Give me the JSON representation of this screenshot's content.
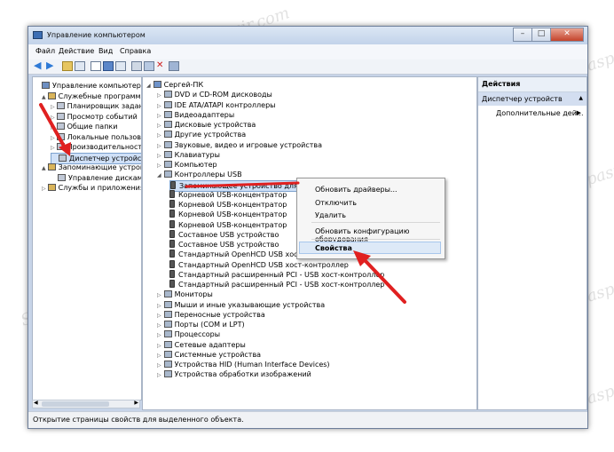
{
  "window": {
    "title": "Управление компьютером",
    "controls": [
      "–",
      "□",
      "✕"
    ]
  },
  "menu": [
    "Файл",
    "Действие",
    "Вид",
    "Справка"
  ],
  "left_tree": [
    {
      "label": "Управление компьютером (л",
      "indent": 0,
      "expander": ""
    },
    {
      "label": "Служебные программы",
      "indent": 1,
      "expander": "▲"
    },
    {
      "label": "Планировщик заданий",
      "indent": 2,
      "expander": "▷"
    },
    {
      "label": "Просмотр событий",
      "indent": 2,
      "expander": "▷"
    },
    {
      "label": "Общие папки",
      "indent": 2,
      "expander": "▷"
    },
    {
      "label": "Локальные пользовате",
      "indent": 2,
      "expander": "▷"
    },
    {
      "label": "Производительность",
      "indent": 2,
      "expander": "▷"
    },
    {
      "label": "Диспетчер устройств",
      "indent": 2,
      "expander": ""
    },
    {
      "label": "Запоминающие устройст",
      "indent": 1,
      "expander": "▲"
    },
    {
      "label": "Управление дисками",
      "indent": 2,
      "expander": ""
    },
    {
      "label": "Службы и приложения",
      "indent": 1,
      "expander": "▷"
    }
  ],
  "device_tree": [
    {
      "label": "Сергей-ПК",
      "indent": 0,
      "expander": "◢"
    },
    {
      "label": "DVD и CD-ROM дисководы",
      "indent": 1,
      "expander": "▷"
    },
    {
      "label": "IDE ATA/ATAPI контроллеры",
      "indent": 1,
      "expander": "▷"
    },
    {
      "label": "Видеоадаптеры",
      "indent": 1,
      "expander": "▷"
    },
    {
      "label": "Дисковые устройства",
      "indent": 1,
      "expander": "▷"
    },
    {
      "label": "Другие устройства",
      "indent": 1,
      "expander": "▷"
    },
    {
      "label": "Звуковые, видео и игровые устройства",
      "indent": 1,
      "expander": "▷"
    },
    {
      "label": "Клавиатуры",
      "indent": 1,
      "expander": "▷"
    },
    {
      "label": "Компьютер",
      "indent": 1,
      "expander": "▷"
    },
    {
      "label": "Контроллеры USB",
      "indent": 1,
      "expander": "◢"
    },
    {
      "label": "Запоминающее устройство для USB",
      "indent": 2,
      "expander": ""
    },
    {
      "label": "Корневой USB-концентратор",
      "indent": 2,
      "expander": ""
    },
    {
      "label": "Корневой USB-концентратор",
      "indent": 2,
      "expander": ""
    },
    {
      "label": "Корневой USB-концентратор",
      "indent": 2,
      "expander": ""
    },
    {
      "label": "Корневой USB-концентратор",
      "indent": 2,
      "expander": ""
    },
    {
      "label": "Составное USB устройство",
      "indent": 2,
      "expander": ""
    },
    {
      "label": "Составное USB устройство",
      "indent": 2,
      "expander": ""
    },
    {
      "label": "Стандартный OpenHCD USB хост-контроллер",
      "indent": 2,
      "expander": ""
    },
    {
      "label": "Стандартный OpenHCD USB хост-контроллер",
      "indent": 2,
      "expander": ""
    },
    {
      "label": "Стандартный расширенный PCI - USB хост-контроллер",
      "indent": 2,
      "expander": ""
    },
    {
      "label": "Стандартный расширенный PCI - USB хост-контроллер",
      "indent": 2,
      "expander": ""
    },
    {
      "label": "Мониторы",
      "indent": 1,
      "expander": "▷"
    },
    {
      "label": "Мыши и иные указывающие устройства",
      "indent": 1,
      "expander": "▷"
    },
    {
      "label": "Переносные устройства",
      "indent": 1,
      "expander": "▷"
    },
    {
      "label": "Порты (COM и LPT)",
      "indent": 1,
      "expander": "▷"
    },
    {
      "label": "Процессоры",
      "indent": 1,
      "expander": "▷"
    },
    {
      "label": "Сетевые адаптеры",
      "indent": 1,
      "expander": "▷"
    },
    {
      "label": "Системные устройства",
      "indent": 1,
      "expander": "▷"
    },
    {
      "label": "Устройства HID (Human Interface Devices)",
      "indent": 1,
      "expander": "▷"
    },
    {
      "label": "Устройства обработки изображений",
      "indent": 1,
      "expander": "▷"
    }
  ],
  "context_menu": {
    "items": [
      "Обновить драйверы...",
      "Отключить",
      "Удалить",
      "Обновить конфигурацию оборудования"
    ],
    "highlighted": "Свойства"
  },
  "actions": {
    "header": "Действия",
    "selected": "Диспетчер устройств",
    "more": "Дополнительные дей...",
    "more_arrow": "▶",
    "collapse_arrow": "▲"
  },
  "status": "Открытие страницы свойств для выделенного объекта.",
  "watermark_text": "Sovinspaspair.com",
  "colors": {
    "annotation": "#e02020",
    "selection": "#cfe0f7",
    "titlebar": "#c2d3ea"
  }
}
